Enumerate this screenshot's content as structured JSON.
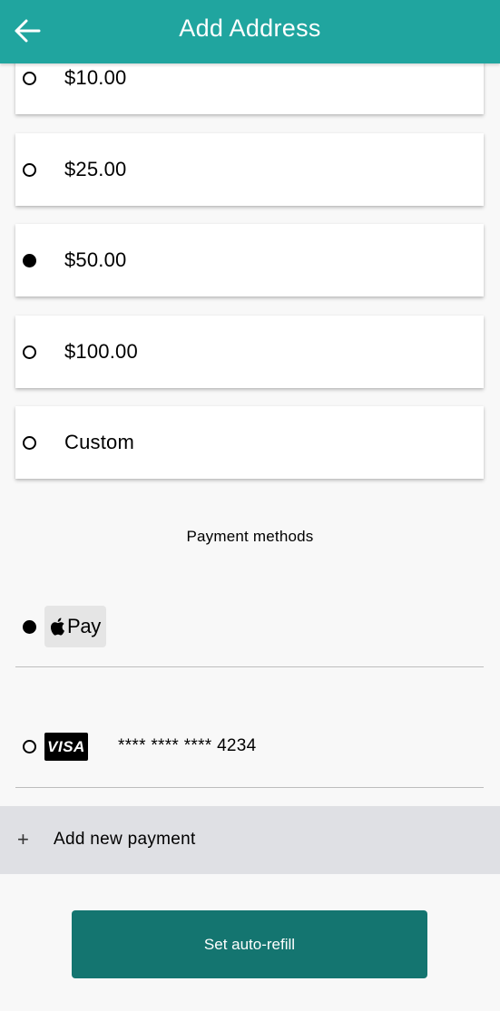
{
  "header": {
    "title": "Add Address",
    "back_icon": "arrow-left-icon",
    "color": "#20a59f"
  },
  "amounts": [
    {
      "label": "$10.00",
      "selected": false
    },
    {
      "label": "$25.00",
      "selected": false
    },
    {
      "label": "$50.00",
      "selected": true
    },
    {
      "label": "$100.00",
      "selected": false
    },
    {
      "label": "Custom",
      "selected": false
    }
  ],
  "payment": {
    "section_title": "Payment methods",
    "methods": [
      {
        "type": "apple-pay",
        "logo_text": "Pay",
        "selected": true
      },
      {
        "type": "visa",
        "logo_text": "VISA",
        "card_number": "**** **** **** 4234",
        "selected": false
      }
    ],
    "add_label": "Add new payment",
    "add_icon": "+"
  },
  "cta": {
    "label": "Set auto-refill",
    "color": "#147570"
  }
}
